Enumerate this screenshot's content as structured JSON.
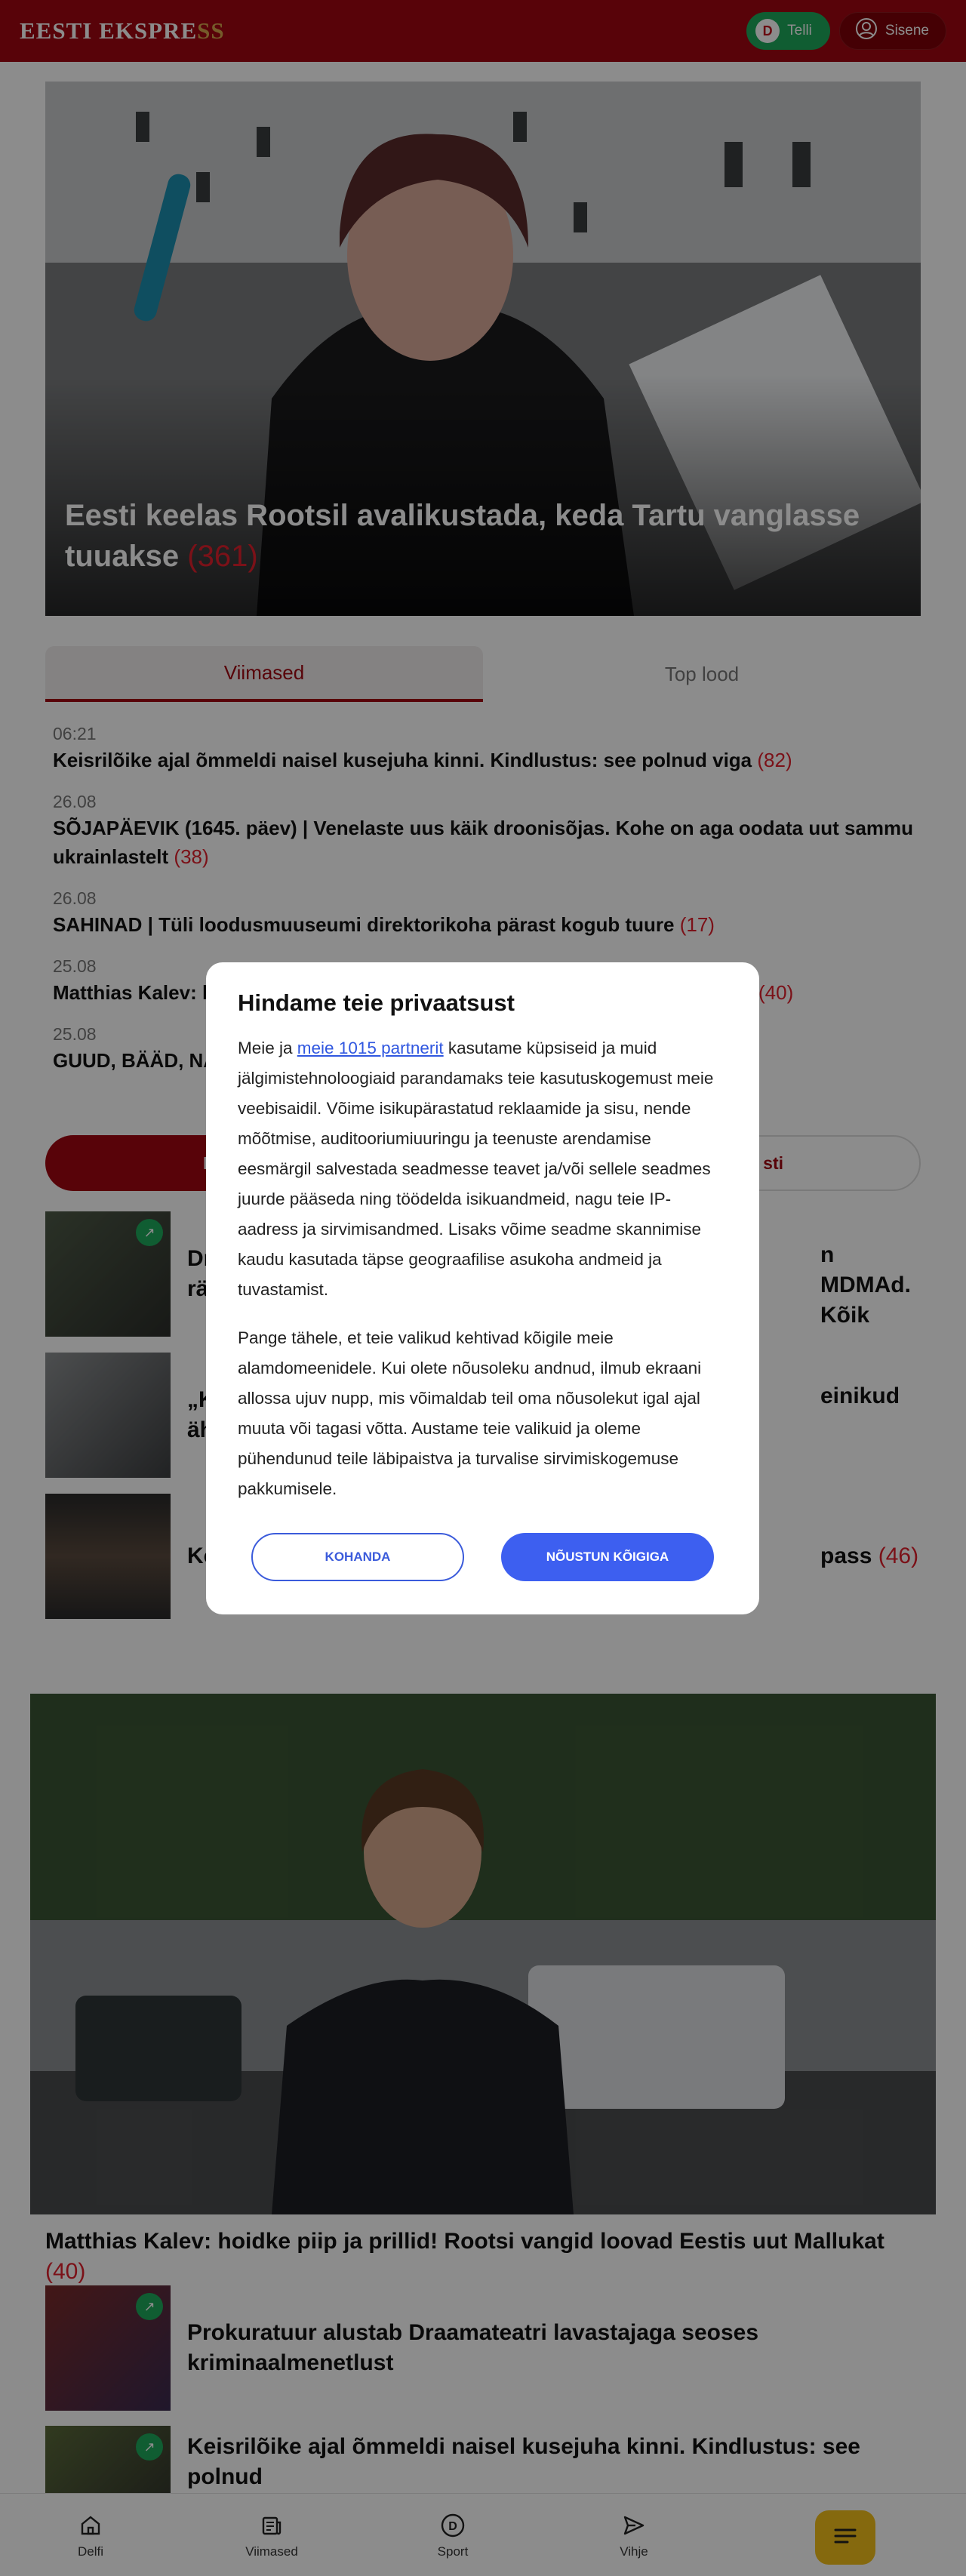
{
  "header": {
    "logo_main": "EESTI EKSPRE",
    "logo_end": "SS",
    "subscribe_badge": "D",
    "subscribe_label": "Telli",
    "login_label": "Sisene"
  },
  "hero": {
    "title": "Eesti keelas Rootsil avalikustada, keda Tartu vanglasse tuuakse",
    "count": "(361)"
  },
  "tabs": [
    {
      "label": "Viimased"
    },
    {
      "label": "Top lood"
    }
  ],
  "latest": [
    {
      "time": "06:21",
      "title": "Keisrilõike ajal õmmeldi naisel kusejuha kinni. Kindlustus: see polnud viga",
      "count": "(82)"
    },
    {
      "time": "26.08",
      "title": "SÕJAPÄEVIK (1645. päev) | Venelaste uus käik droonisõjas. Kohe on aga oodata uut sammu ukrainlastelt",
      "count": "(38)"
    },
    {
      "time": "26.08",
      "title": "SAHINAD | Tüli loodusmuuseumi direktorikoha pärast kogub tuure",
      "count": "(17)"
    },
    {
      "time": "25.08",
      "title": "Matthias Kalev: h",
      "count": "(40)"
    },
    {
      "time": "25.08",
      "title": "GUUD, BÄÄD, NÄ",
      "count": ""
    }
  ],
  "loe": {
    "left": "Loe v",
    "right": "sti"
  },
  "stories": [
    {
      "title": "Dr",
      "title2": "rä",
      "end": "n MDMAd. Kõik"
    },
    {
      "title": "„K",
      "title2": "äh",
      "end": "einikud"
    },
    {
      "title": "Ko",
      "end": "pass",
      "count": "(46)"
    }
  ],
  "big2": {
    "title": "Matthias Kalev: hoidke piip ja prillid! Rootsi vangid loovad Eestis uut Mallukat",
    "count": "(40)"
  },
  "more_stories": [
    {
      "title": "Prokuratuur alustab Draamateatri lavastajaga seoses kriminaalmenetlust"
    },
    {
      "title": "Keisrilõike ajal õmmeldi naisel kusejuha kinni. Kindlustus: see polnud"
    }
  ],
  "bottomnav": [
    {
      "label": "Delfi",
      "icon": "home-icon"
    },
    {
      "label": "Viimased",
      "icon": "news-icon"
    },
    {
      "label": "Sport",
      "icon": "sport-icon"
    },
    {
      "label": "Vihje",
      "icon": "send-icon"
    }
  ],
  "consent": {
    "title": "Hindame teie privaatsust",
    "p1_before": "Meie ja ",
    "p1_link": "meie 1015 partnerit",
    "p1_after": " kasutame küpsiseid ja muid jälgimistehnoloogiaid parandamaks teie kasutuskogemust meie veebisaidil. Võime isikupärastatud reklaamide ja sisu, nende mõõtmise, auditooriumiuuringu ja teenuste arendamise eesmärgil salvestada seadmesse teavet ja/või sellele seadmes juurde pääseda ning töödelda isikuandmeid, nagu teie IP-aadress ja sirvimisandmed. Lisaks võime seadme skannimise kaudu kasutada täpse geograafilise asukoha andmeid ja tuvastamist.",
    "p2": "Pange tähele, et teie valikud kehtivad kõigile meie alamdomeenidele. Kui olete nõusoleku andnud, ilmub ekraani allossa ujuv nupp, mis võimaldab teil oma nõusolekut igal ajal muuta või tagasi võtta. Austame teie valikuid ja oleme pühendunud teile läbipaistva ja turvalise sirvimiskogemuse pakkumisele.",
    "customize": "KOHANDA",
    "accept": "NÕUSTUN KÕIGIGA"
  }
}
